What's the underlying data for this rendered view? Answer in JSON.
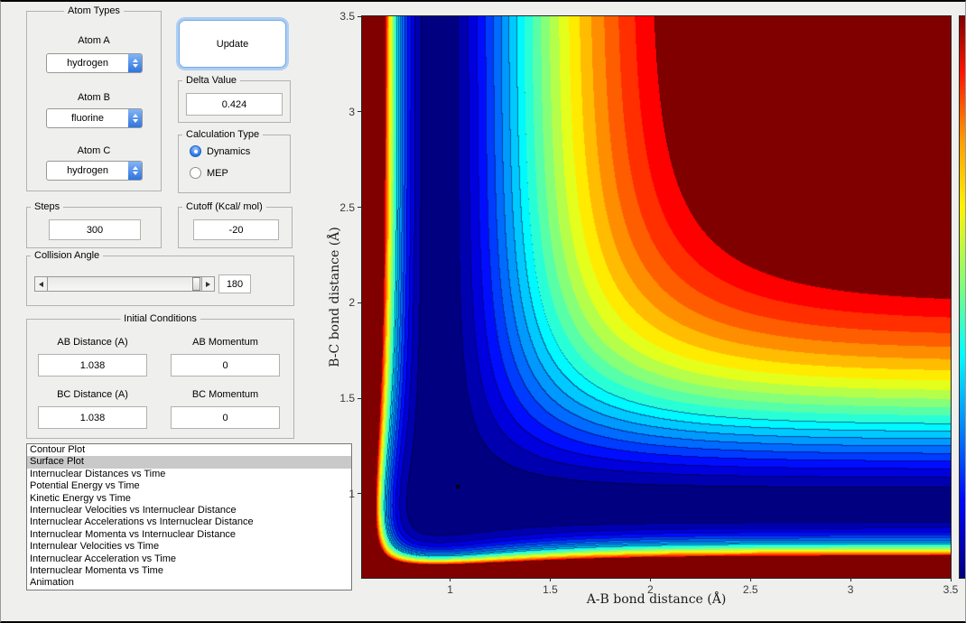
{
  "panels": {
    "atom_types": {
      "title": "Atom Types",
      "fields": [
        {
          "label": "Atom A",
          "value": "hydrogen"
        },
        {
          "label": "Atom B",
          "value": "fluorine"
        },
        {
          "label": "Atom C",
          "value": "hydrogen"
        }
      ]
    },
    "update": {
      "label": "Update"
    },
    "delta": {
      "title": "Delta Value",
      "value": "0.424"
    },
    "calculation_type": {
      "title": "Calculation Type",
      "options": [
        {
          "label": "Dynamics",
          "selected": true
        },
        {
          "label": "MEP",
          "selected": false
        }
      ]
    },
    "steps": {
      "title": "Steps",
      "value": "300"
    },
    "cutoff": {
      "title": "Cutoff (Kcal/ mol)",
      "value": "-20"
    },
    "collision_angle": {
      "title": "Collision Angle",
      "value": "180"
    },
    "initial_conditions": {
      "title": "Initial Conditions",
      "fields": [
        {
          "label": "AB Distance (A)",
          "value": "1.038"
        },
        {
          "label": "AB Momentum",
          "value": "0"
        },
        {
          "label": "BC Distance (A)",
          "value": "1.038"
        },
        {
          "label": "BC Momentum",
          "value": "0"
        }
      ]
    }
  },
  "plot_list": {
    "selected_index": 1,
    "items": [
      "Contour Plot",
      "Surface Plot",
      "Internuclear Distances vs Time",
      "Potential Energy vs Time",
      "Kinetic Energy vs Time",
      "Internuclear Velocities vs Internuclear Distance",
      "Internuclear Accelerations vs Internuclear Distance",
      "Internuclear Momenta vs Internuclear Distance",
      "Internulear Velocities vs Time",
      "Internuclear Acceleration vs Time",
      "Internuclear Momenta vs Time",
      "Animation"
    ]
  },
  "chart_data": {
    "type": "heatmap",
    "subtype": "filled_contour_potential_energy_surface",
    "title": "",
    "xlabel": "A-B bond distance (Å)",
    "ylabel": "B-C bond distance (Å)",
    "xlim": [
      0.56,
      3.5
    ],
    "ylim": [
      0.56,
      3.5
    ],
    "xticks": [
      1,
      1.5,
      2,
      2.5,
      3,
      3.5
    ],
    "yticks": [
      1,
      1.5,
      2,
      2.5,
      3,
      3.5
    ],
    "colormap": "jet",
    "legend": "none",
    "grid": false,
    "marker": {
      "x": 1.038,
      "y": 1.038,
      "color": "#000000"
    },
    "description": "LEPS-style H-F-H potential energy surface: dark-blue L-shaped minimum-energy valley along r=0.93 Å in each coordinate, rainbow contour bands rising to a flat dark-red dissociation plateau clipped at the -20 kcal/mol cutoff, steep repulsive dark-red walls at short bond distances",
    "surface_model": {
      "form": "V = De*(u*v - 1) + K*exp(-b*(x-r0)) + K*exp(-b*(y-r0)); u=(1-exp(-a*(x-re)))^2, v=(1-exp(-a*(y-re)))^2",
      "De": 100,
      "re": 0.93,
      "a": 2.1,
      "K": 80,
      "b": 20,
      "r0": 0.63,
      "clip_lo": -100,
      "clip_hi": -20,
      "n_levels": 20
    }
  }
}
